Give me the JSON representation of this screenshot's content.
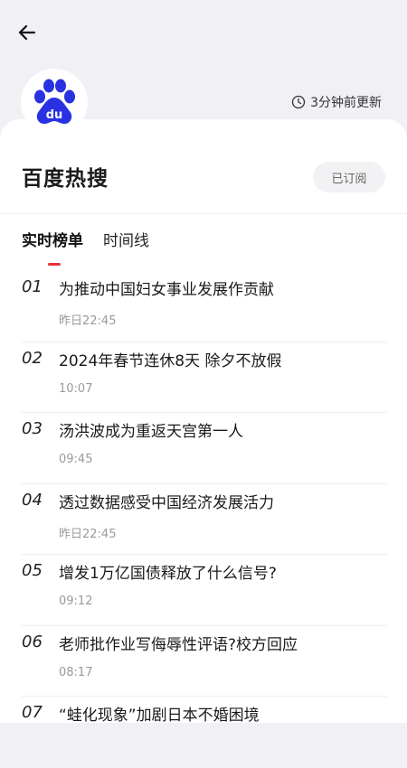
{
  "header": {
    "update_text": "3分钟前更新"
  },
  "card": {
    "title": "百度热搜",
    "subscribe_label": "已订阅"
  },
  "tabs": [
    {
      "label": "实时榜单",
      "active": true
    },
    {
      "label": "时间线",
      "active": false
    }
  ],
  "items": [
    {
      "rank": "01",
      "title": "为推动中国妇女事业发展作贡献",
      "time": "昨日22:45"
    },
    {
      "rank": "02",
      "title": "2024年春节连休8天 除夕不放假",
      "time": "10:07"
    },
    {
      "rank": "03",
      "title": "汤洪波成为重返天宫第一人",
      "time": "09:45"
    },
    {
      "rank": "04",
      "title": "透过数据感受中国经济发展活力",
      "time": "昨日22:45"
    },
    {
      "rank": "05",
      "title": "增发1万亿国债释放了什么信号?",
      "time": "09:12"
    },
    {
      "rank": "06",
      "title": "老师批作业写侮辱性评语?校方回应",
      "time": "08:17"
    },
    {
      "rank": "07",
      "title": "“蛙化现象”加剧日本不婚困境",
      "time": ""
    }
  ],
  "colors": {
    "accent": "#e8323c",
    "baidu_blue": "#2932e1"
  }
}
